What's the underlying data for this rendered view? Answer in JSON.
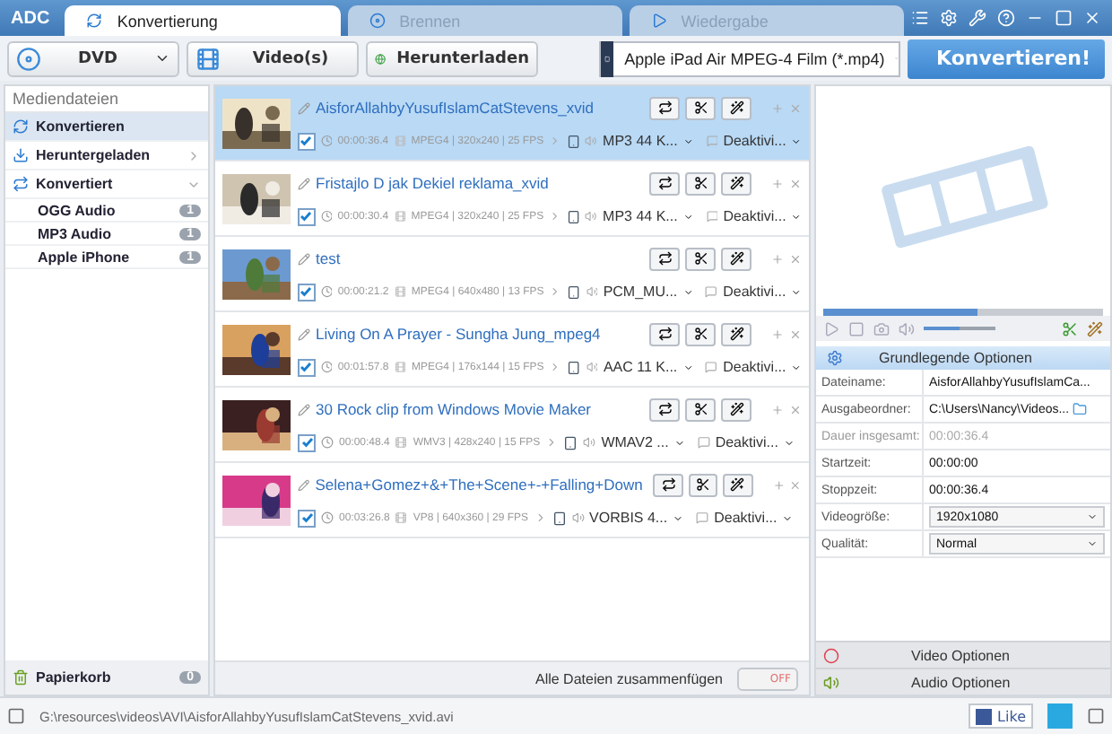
{
  "app": {
    "logo": "ADC"
  },
  "tabs": [
    {
      "label": "Konvertierung",
      "selected": true
    },
    {
      "label": "Brennen",
      "selected": false
    },
    {
      "label": "Wiedergabe",
      "selected": false
    }
  ],
  "toolbar": {
    "add_buttons": [
      {
        "label": "DVD",
        "kind": "disc",
        "dropdown": true
      },
      {
        "label": "Video(s)",
        "kind": "film",
        "dropdown": false
      },
      {
        "label": "Herunterladen",
        "kind": "globe",
        "dropdown": false
      }
    ],
    "profile": "Apple iPad Air MPEG-4 Film (*.mp4)",
    "convert": "Konvertieren!"
  },
  "sidebar": {
    "header": "Mediendateien",
    "items": [
      {
        "label": "Konvertieren",
        "selected": true,
        "kind": "convert",
        "expanded": false
      },
      {
        "label": "Heruntergeladen",
        "selected": false,
        "kind": "download",
        "expanded": false
      },
      {
        "label": "Konvertiert",
        "selected": false,
        "kind": "converted",
        "expanded": true,
        "children": [
          {
            "label": "OGG Audio",
            "count": "1"
          },
          {
            "label": "MP3 Audio",
            "count": "1"
          },
          {
            "label": "Apple iPhone",
            "count": "1"
          }
        ]
      }
    ],
    "trash": {
      "label": "Papierkorb",
      "count": "0"
    }
  },
  "files": [
    {
      "name": "AisforAllahbyYusufIslamCatStevens_xvid",
      "checked": true,
      "selected": true,
      "duration": "00:00:36.4",
      "info": "MPEG4 | 320x240 | 25 FPS",
      "audio": "MP3 44 K...",
      "subtitle": "Deaktivi..."
    },
    {
      "name": "Fristajlo D jak Dekiel reklama_xvid",
      "checked": true,
      "selected": false,
      "duration": "00:00:30.4",
      "info": "MPEG4 | 320x240 | 25 FPS",
      "audio": "MP3 44 K...",
      "subtitle": "Deaktivi..."
    },
    {
      "name": "test",
      "checked": true,
      "selected": false,
      "duration": "00:00:21.2",
      "info": "MPEG4 | 640x480 | 13 FPS",
      "audio": "PCM_MU...",
      "subtitle": "Deaktivi..."
    },
    {
      "name": "Living On A Prayer - Sungha Jung_mpeg4",
      "checked": true,
      "selected": false,
      "duration": "00:01:57.8",
      "info": "MPEG4 | 176x144 | 15 FPS",
      "audio": "AAC 11 K...",
      "subtitle": "Deaktivi..."
    },
    {
      "name": "30 Rock clip from Windows Movie Maker",
      "checked": true,
      "selected": false,
      "duration": "00:00:48.4",
      "info": "WMV3 | 428x240 | 15 FPS",
      "audio": "WMAV2 ...",
      "subtitle": "Deaktivi..."
    },
    {
      "name": "Selena+Gomez+&+The+Scene+-+Falling+Down",
      "checked": true,
      "selected": false,
      "duration": "00:03:26.8",
      "info": "VP8 | 640x360 | 29 FPS",
      "audio": "VORBIS 4...",
      "subtitle": "Deaktivi..."
    }
  ],
  "merge": {
    "label": "Alle Dateien zusammenfügen",
    "toggle_text": "OFF",
    "on": false
  },
  "preview": {
    "level": 0.55,
    "volume": {
      "level": 0.5
    }
  },
  "options": {
    "header": "Grundlegende Optionen",
    "rows": [
      {
        "label": "Dateiname:",
        "value": "AisforAllahbyYusufIslamCa...",
        "kind": "text",
        "disabled": false
      },
      {
        "label": "Ausgabeordner:",
        "value": "C:\\Users\\Nancy\\Videos...",
        "kind": "folder",
        "disabled": false
      },
      {
        "label": "Dauer insgesamt:",
        "value": "00:00:36.4",
        "kind": "text",
        "disabled": true
      },
      {
        "label": "Startzeit:",
        "value": "00:00:00",
        "kind": "text",
        "disabled": false
      },
      {
        "label": "Stoppzeit:",
        "value": "00:00:36.4",
        "kind": "text",
        "disabled": false
      },
      {
        "label": "Videogröße:",
        "value": "1920x1080",
        "kind": "select",
        "disabled": false
      },
      {
        "label": "Qualität:",
        "value": "Normal",
        "kind": "select",
        "disabled": false
      }
    ]
  },
  "sections": [
    {
      "label": "Video Optionen",
      "kind": "video"
    },
    {
      "label": "Audio Optionen",
      "kind": "audio"
    }
  ],
  "status": {
    "path": "G:\\resources\\videos\\AVI\\AisforAllahbyYusufIslamCatStevens_xvid.avi",
    "like": "Like"
  }
}
